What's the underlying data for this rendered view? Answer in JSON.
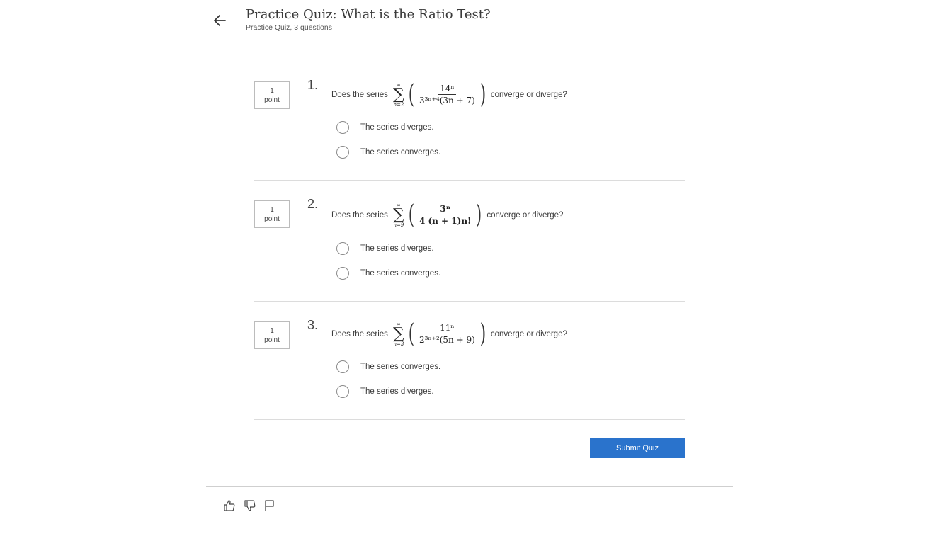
{
  "header": {
    "title": "Practice Quiz: What is the Ratio Test?",
    "subtitle": "Practice Quiz, 3 questions",
    "back_icon": "arrow-left-icon"
  },
  "questions": [
    {
      "points_value": "1",
      "points_unit": "point",
      "number": "1.",
      "prompt_pre": "Does the series",
      "prompt_post": "converge or diverge?",
      "formula": {
        "sum_upper": "∞",
        "sum_lower": "n=2",
        "numerator": "14ⁿ",
        "denominator": "3³ⁿ⁺⁴(3n + 7)",
        "bold": false
      },
      "options": [
        "The series diverges.",
        "The series converges."
      ]
    },
    {
      "points_value": "1",
      "points_unit": "point",
      "number": "2.",
      "prompt_pre": "Does the series",
      "prompt_post": "converge or diverge?",
      "formula": {
        "sum_upper": "∞",
        "sum_lower": "n=9",
        "numerator": "3ⁿ",
        "denominator": "4 (n + 1)n!",
        "bold": true
      },
      "options": [
        "The series diverges.",
        "The series converges."
      ]
    },
    {
      "points_value": "1",
      "points_unit": "point",
      "number": "3.",
      "prompt_pre": "Does the series",
      "prompt_post": "converge or diverge?",
      "formula": {
        "sum_upper": "∞",
        "sum_lower": "n=3",
        "numerator": "11ⁿ",
        "denominator": "2³ⁿ⁺²(5n + 9)",
        "bold": false
      },
      "options": [
        "The series converges.",
        "The series diverges."
      ]
    }
  ],
  "submit_label": "Submit Quiz",
  "accent_color": "#2a73cc",
  "footer": {
    "icons": [
      "thumbs-up-icon",
      "thumbs-down-icon",
      "flag-icon"
    ]
  }
}
